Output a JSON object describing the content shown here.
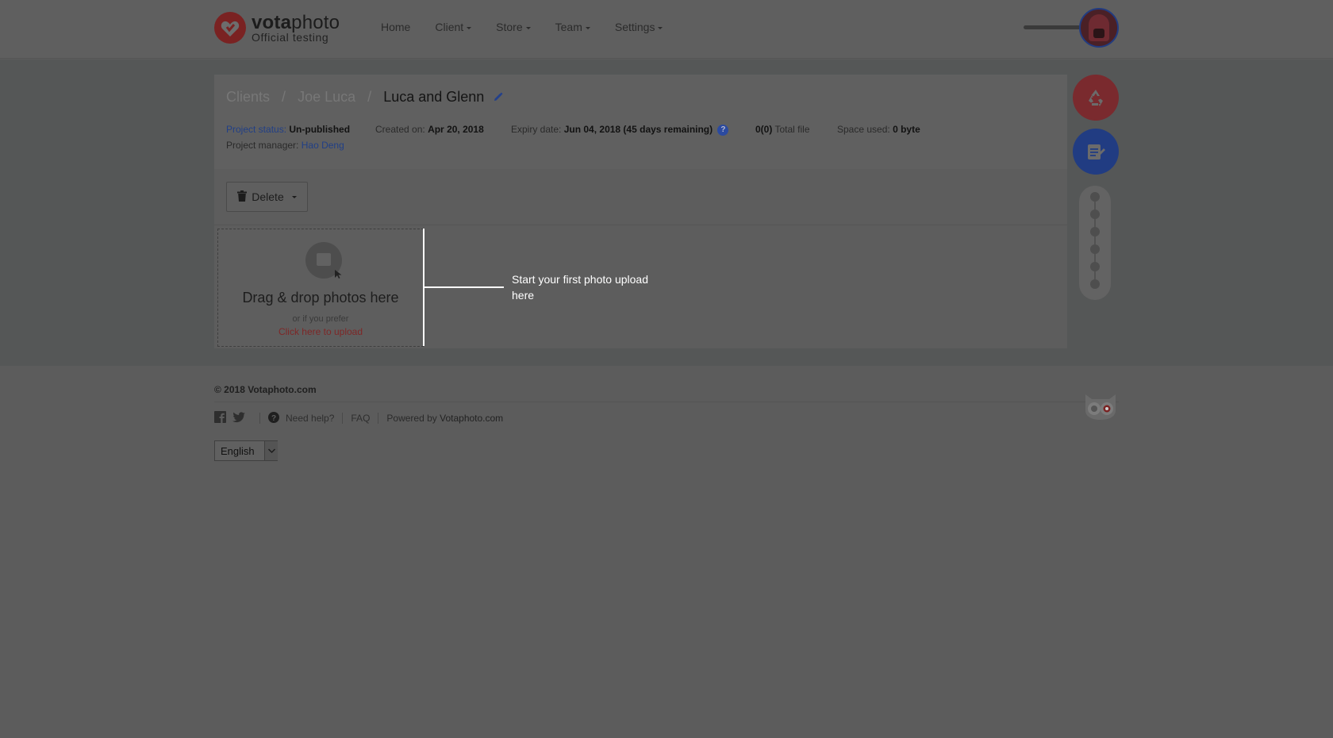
{
  "brand": {
    "name_bold": "vota",
    "name_light": "photo",
    "subtitle": "Official testing"
  },
  "nav": {
    "items": [
      {
        "label": "Home",
        "has_caret": false
      },
      {
        "label": "Client",
        "has_caret": true
      },
      {
        "label": "Store",
        "has_caret": true
      },
      {
        "label": "Team",
        "has_caret": true
      },
      {
        "label": "Settings",
        "has_caret": true
      }
    ]
  },
  "breadcrumb": {
    "items": [
      "Clients",
      "Joe Luca"
    ],
    "current": "Luca and Glenn",
    "separator": "/"
  },
  "project": {
    "status_label": "Project status:",
    "status_value": "Un-published",
    "created_label": "Created on:",
    "created_value": "Apr 20, 2018",
    "expiry_label": "Expiry date:",
    "expiry_value": "Jun 04, 2018 (45 days remaining)",
    "help_glyph": "?",
    "files_count": "0(0)",
    "files_label": "Total file",
    "space_label": "Space used:",
    "space_value": "0 byte",
    "manager_label": "Project manager:",
    "manager_value": "Hao Deng"
  },
  "toolbar": {
    "delete_label": "Delete"
  },
  "dropzone": {
    "title": "Drag & drop photos here",
    "subtitle": "or if you prefer",
    "link": "Click here to upload"
  },
  "tooltip": {
    "text": "Start your first photo upload here"
  },
  "footer": {
    "copyright": "© 2018 Votaphoto.com",
    "help_label": "Need help?",
    "faq_label": "FAQ",
    "powered_prefix": "Powered by",
    "powered_name": "Votaphoto.com",
    "language": "English"
  },
  "icons": {
    "logo": "heart-logo-icon",
    "edit": "pencil-icon",
    "trash": "trash-icon",
    "recycle": "recycle-icon",
    "notes": "notes-edit-icon",
    "facebook": "facebook-icon",
    "twitter": "twitter-icon",
    "help": "question-circle-icon",
    "owl": "owl-icon"
  },
  "colors": {
    "brand_red": "#7a2a2e",
    "action_blue": "#213c82",
    "overlay": "#5c5c5c"
  }
}
